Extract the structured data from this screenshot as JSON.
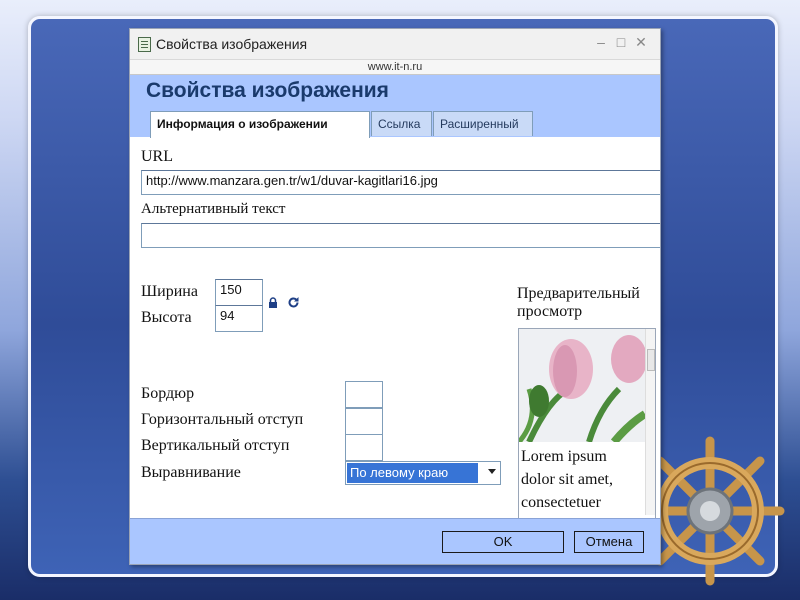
{
  "window": {
    "title": "Свойства изображения",
    "url_caption": "www.it-n.ru"
  },
  "dialog": {
    "heading": "Свойства изображения",
    "tabs": [
      {
        "label": "Информация о изображении",
        "active": true
      },
      {
        "label": "Ссылка",
        "active": false
      },
      {
        "label": "Расширенный",
        "active": false
      }
    ],
    "url_label": "URL",
    "url_value": "http://www.manzara.gen.tr/w1/duvar-kagitlari16.jpg",
    "alt_label": "Альтернативный текст",
    "alt_value": "",
    "width_label": "Ширина",
    "width_value": "150",
    "height_label": "Высота",
    "height_value": "94",
    "border_label": "Бордюр",
    "hspace_label": "Горизонтальный отступ",
    "vspace_label": "Вертикальный отступ",
    "align_label": "Выравнивание",
    "align_value": "По левому краю",
    "preview_label_line1": "Предварительный",
    "preview_label_line2": "просмотр",
    "preview_text": "Lorem ipsum dolor sit amet, consectetuer",
    "ok_label": "OK",
    "cancel_label": "Отмена"
  },
  "icons": {
    "lock": "lock-icon",
    "reset": "reset-size-icon"
  },
  "colors": {
    "header_band": "#aac6ff",
    "title_text": "#1a3a6c",
    "selection": "#3774d6"
  }
}
